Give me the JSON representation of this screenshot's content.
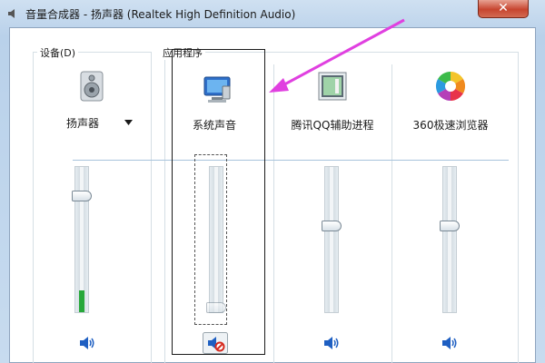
{
  "window": {
    "title": "音量合成器 - 扬声器 (Realtek High Definition Audio)",
    "close_label": "✕"
  },
  "device_group": {
    "label": "设备(D)"
  },
  "apps_group": {
    "label": "应用程序"
  },
  "columns": [
    {
      "name": "扬声器",
      "icon": "speaker-device-icon",
      "volume": 0.82,
      "level": 0.15,
      "dropdown": true
    },
    {
      "name": "系统声音",
      "icon": "system-sounds-icon",
      "volume": 0.0,
      "muted": true
    },
    {
      "name": "腾讯QQ辅助进程",
      "icon": "qq-helper-icon",
      "volume": 0.6
    },
    {
      "name": "360极速浏览器",
      "icon": "browser-360-icon",
      "volume": 0.6
    }
  ],
  "colors": {
    "annotation_arrow": "#e040e0",
    "level_meter": "#27a83a"
  }
}
